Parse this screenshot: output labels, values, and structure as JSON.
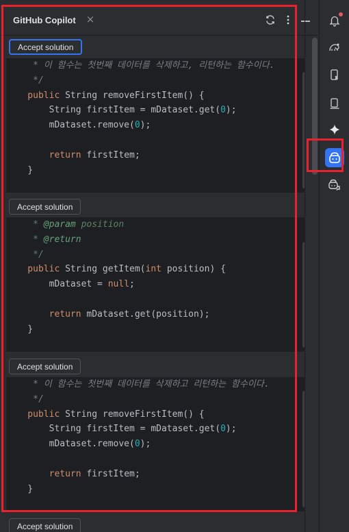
{
  "panel": {
    "title": "GitHub Copilot",
    "close_glyph": "×",
    "header_icons": [
      "refresh-icon",
      "more-vertical-icon",
      "minimize-icon"
    ]
  },
  "sidebar": {
    "items": [
      {
        "name": "notifications-bell-icon",
        "has_badge": true
      },
      {
        "name": "gradle-elephant-icon"
      },
      {
        "name": "device-manager-icon"
      },
      {
        "name": "running-devices-icon"
      },
      {
        "name": "gemini-sparkle-icon"
      },
      {
        "name": "copilot-icon",
        "active": true
      },
      {
        "name": "copilot-chat-icon"
      }
    ]
  },
  "accept_label": "Accept solution",
  "solutions": [
    {
      "button": "Accept solution",
      "lines": [
        [
          {
            "t": "     * 이 함수는 첫번째 데이터를 삭제하고, 리턴하는 함수이다.",
            "c": "cm"
          }
        ],
        [
          {
            "t": "     */",
            "c": "cm"
          }
        ],
        [
          {
            "t": "    public",
            "c": "kw"
          },
          {
            "t": " String removeFirstItem() {",
            "c": "plain"
          }
        ],
        [
          {
            "t": "        String firstItem = mDataset.get(",
            "c": "plain"
          },
          {
            "t": "0",
            "c": "num"
          },
          {
            "t": ");",
            "c": "plain"
          }
        ],
        [
          {
            "t": "        mDataset.remove(",
            "c": "plain"
          },
          {
            "t": "0",
            "c": "num"
          },
          {
            "t": ");",
            "c": "plain"
          }
        ],
        [
          {
            "t": "",
            "c": "plain"
          }
        ],
        [
          {
            "t": "        return",
            "c": "kw"
          },
          {
            "t": " firstItem;",
            "c": "plain"
          }
        ],
        [
          {
            "t": "    }",
            "c": "plain"
          }
        ]
      ]
    },
    {
      "button": "Accept solution",
      "lines": [
        [
          {
            "t": "     * ",
            "c": "doc"
          },
          {
            "t": "@param",
            "c": "tag"
          },
          {
            "t": " position",
            "c": "doc"
          }
        ],
        [
          {
            "t": "     * ",
            "c": "doc"
          },
          {
            "t": "@return",
            "c": "tag"
          }
        ],
        [
          {
            "t": "     */",
            "c": "doc"
          }
        ],
        [
          {
            "t": "    public",
            "c": "kw"
          },
          {
            "t": " String getItem(",
            "c": "plain"
          },
          {
            "t": "int",
            "c": "kw"
          },
          {
            "t": " position) {",
            "c": "plain"
          }
        ],
        [
          {
            "t": "        mDataset = ",
            "c": "plain"
          },
          {
            "t": "null",
            "c": "kw"
          },
          {
            "t": ";",
            "c": "plain"
          }
        ],
        [
          {
            "t": "",
            "c": "plain"
          }
        ],
        [
          {
            "t": "        return",
            "c": "kw"
          },
          {
            "t": " mDataset.get(position);",
            "c": "plain"
          }
        ],
        [
          {
            "t": "    }",
            "c": "plain"
          }
        ]
      ]
    },
    {
      "button": "Accept solution",
      "lines": [
        [
          {
            "t": "     * 이 함수는 첫번째 데이터를 삭제하고 리턴하는 함수이다.",
            "c": "cm"
          }
        ],
        [
          {
            "t": "     */",
            "c": "cm"
          }
        ],
        [
          {
            "t": "    public",
            "c": "kw"
          },
          {
            "t": " String removeFirstItem() {",
            "c": "plain"
          }
        ],
        [
          {
            "t": "        String firstItem = mDataset.get(",
            "c": "plain"
          },
          {
            "t": "0",
            "c": "num"
          },
          {
            "t": ");",
            "c": "plain"
          }
        ],
        [
          {
            "t": "        mDataset.remove(",
            "c": "plain"
          },
          {
            "t": "0",
            "c": "num"
          },
          {
            "t": ");",
            "c": "plain"
          }
        ],
        [
          {
            "t": "",
            "c": "plain"
          }
        ],
        [
          {
            "t": "        return",
            "c": "kw"
          },
          {
            "t": " firstItem;",
            "c": "plain"
          }
        ],
        [
          {
            "t": "    }",
            "c": "plain"
          }
        ]
      ]
    },
    {
      "button": "Accept solution",
      "lines": []
    }
  ],
  "colors": {
    "accent": "#3574f0",
    "highlight": "#e8232d",
    "editor_bg": "#1e1f22",
    "panel_bg": "#2b2d30"
  }
}
